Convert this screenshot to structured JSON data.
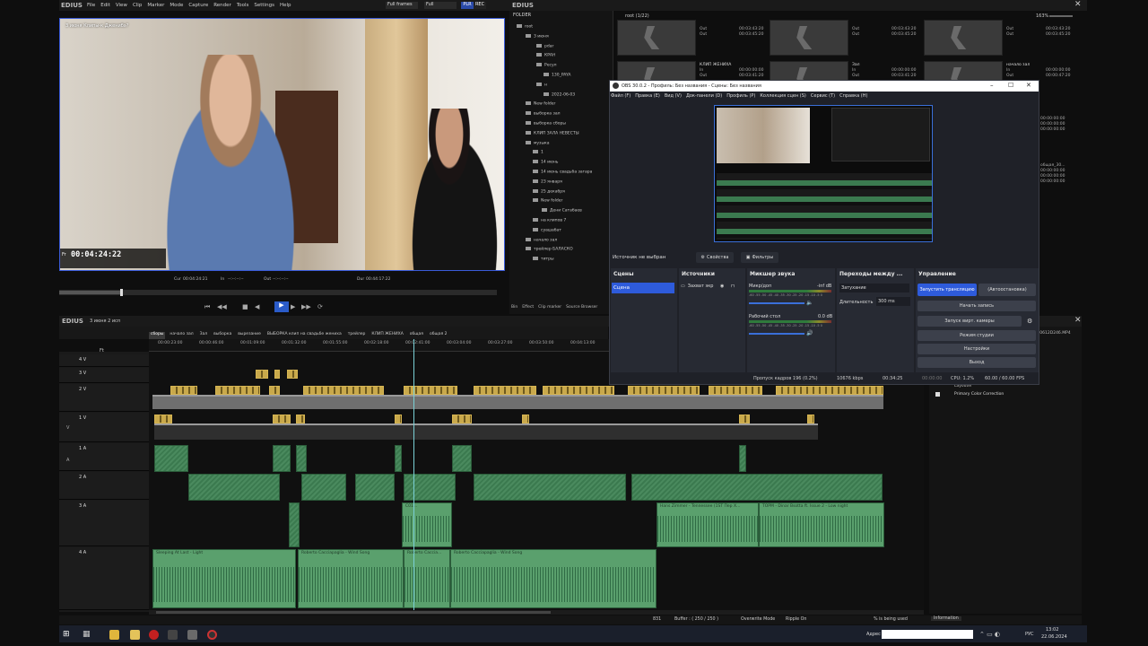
{
  "edius_left": {
    "logo": "EDIUS",
    "menu": [
      "File",
      "Edit",
      "View",
      "Clip",
      "Marker",
      "Mode",
      "Capture",
      "Render",
      "Tools",
      "Settings",
      "Help"
    ],
    "frames_dropdown": "Full frames",
    "quality_dropdown": "Full",
    "plr_label": "PLR",
    "rec_label": "REC"
  },
  "preview": {
    "overlay_title": "3 июня Клипы-к Дженибэ?",
    "timecode_prefix": "Fr",
    "timecode": "00:04:24:22",
    "cur_label": "Cur",
    "cur_value": "00:04:24:21",
    "in_label": "In",
    "in_value": "--:--:--:--",
    "out_label": "Out",
    "out_value": "--:--:--:--",
    "dur_label": "Dur",
    "dur_value": "00:44:17:22"
  },
  "edius_right": {
    "logo": "EDIUS",
    "folder_header": "FOLDER",
    "bin_path": "root (1/22)",
    "zoom": "163%",
    "bottom_tabs": [
      "Bin",
      "Effect",
      "Clip marker",
      "Source Browser"
    ]
  },
  "folder_tree": [
    "root",
    "3 июня",
    "рdar",
    "КРАН",
    "Ресул",
    "130_PAYA",
    "н",
    "2022-06-03",
    "New folder",
    "выборка зал",
    "выборка сборы",
    "КЛИП ЗАЛА НЕВЕСТЫ",
    "музыка",
    "1",
    "14 июнь",
    "14 июнь свадьба загара",
    "23 января",
    "25 декабря",
    "New folder",
    "Дени Сатабаев",
    "на клипов 7",
    "суашабат",
    "начало зал",
    "трейлер БАЛАСКО",
    "титры"
  ],
  "bin_clips": [
    {
      "name": "",
      "lines": [
        "Out",
        "Out"
      ],
      "times": [
        "00:03:43:20",
        "00:03:45:20"
      ]
    },
    {
      "name": "",
      "lines": [
        "Out",
        "Out"
      ],
      "times": [
        "00:03:43:20",
        "00:03:45:20"
      ]
    },
    {
      "name": "",
      "lines": [
        "Out",
        "Out"
      ],
      "times": [
        "00:03:43:20",
        "00:03:45:20"
      ]
    },
    {
      "name": "КЛИП ЖЕНИХА",
      "lines": [
        "In",
        "Out"
      ],
      "times": [
        "00:00:00:00",
        "00:03:41:20"
      ]
    },
    {
      "name": "Зал",
      "lines": [
        "In",
        "Out"
      ],
      "times": [
        "00:00:00:00",
        "00:03:41:20"
      ]
    },
    {
      "name": "начало зал",
      "lines": [
        "In",
        "Out"
      ],
      "times": [
        "00:00:00:00",
        "00:00:47:20"
      ]
    }
  ],
  "bin_side_times": [
    "00:00:00:00",
    "00:00:00:00",
    "00:00:00:00"
  ],
  "bin_side_name": "общая_30...",
  "bin_side_times2": [
    "00:00:00:00",
    "00:00:00:00",
    "00:00:00:00"
  ],
  "timeline": {
    "logo": "EDIUS",
    "sequence_name": "3 июня 2 исп",
    "ft_label": "Ft",
    "seq_tabs": [
      "сборы",
      "начало зал",
      "Зал",
      "выборка",
      "вырезание",
      "ВЫБОРКА клип на свадьбе жениха",
      "трейлер",
      "КЛИП ЖЕНИХА",
      "общая",
      "общая 2"
    ],
    "ruler": [
      "00:00:23:00",
      "00:00:46:00",
      "00:01:09:00",
      "00:01:32:00",
      "00:01:55:00",
      "00:02:18:00",
      "00:02:41:00",
      "00:03:04:00",
      "00:03:27:00",
      "00:03:50:00",
      "00:04:13:00"
    ],
    "tracks": [
      {
        "label": "4 V"
      },
      {
        "label": "3 V"
      },
      {
        "label": "2 V"
      },
      {
        "label": "1 V"
      },
      {
        "label": "1 A"
      },
      {
        "label": "2 A"
      },
      {
        "label": "3 A"
      },
      {
        "label": "4 A"
      }
    ],
    "v_marker": "V",
    "a_marker": "A",
    "clip_labels_3a": [
      "Hans Zimmer - Tennessee (1ST Пер Х...",
      "ТОРМ - Dinar Bsotta ft. Issue 2 - Low night",
      "С01...",
      "С0109"
    ],
    "clip_labels_4a": [
      "Sleeping At Last - Light",
      "Roberto Cacciapaglia - Wind Song",
      "Roberto Caccia...",
      "Roberto Cacciapaglia - Wind Song"
    ],
    "clip_labels_1a": [
      "С0...",
      "С0...",
      "С0...",
      "С0108"
    ]
  },
  "status_bar": {
    "num": "831",
    "buffer": "Buffer : ( 250 / 250 )",
    "mode": "Overwrite Mode",
    "ripple": "Ripple On",
    "percent": "% is being used"
  },
  "info_panel": {
    "tab": "Information",
    "file": "...0612D246.MP4",
    "item_header": "Layouter",
    "item": "Primary Color Correction"
  },
  "obs": {
    "title": "OBS 30.0.2 - Профиль: Без названия - Сцены: Без названия",
    "menu": [
      "Файл (F)",
      "Правка (E)",
      "Вид (V)",
      "Док-панели (D)",
      "Профиль (P)",
      "Коллекция сцен (S)",
      "Сервис (T)",
      "Справка (H)"
    ],
    "no_source": "Источник не выбран",
    "properties": "Свойства",
    "filters": "Фильтры",
    "scenes_title": "Сцены",
    "scene_item": "Сцена",
    "sources_title": "Источники",
    "source_item": "Захват экр",
    "mixer_title": "Микшер звука",
    "mic_name": "Микр/доп",
    "mic_db": "-inf dB",
    "desktop_name": "Рабочий стол",
    "desktop_db": "0.0 dB",
    "meter_scale": "-60 -55 -50 -45 -40 -35 -30 -25 -20 -15 -10 -5 0",
    "transitions_title": "Переходы между ...",
    "transition_type": "Затухание",
    "duration_label": "Длительность",
    "duration_value": "300 ms",
    "controls_title": "Управление",
    "btn_stream": "Запустить трансляцию",
    "btn_auto": "(Автоостановка)",
    "btn_record": "Начать запись",
    "btn_vcam": "Запуск вирт. камеры",
    "btn_studio": "Режим студии",
    "btn_settings": "Настройки",
    "btn_exit": "Выход",
    "status_dropped": "Пропуск кадров 196 (0.2%)",
    "status_kbps": "10676 kbps",
    "status_rec": "00:34:25",
    "status_time2": "00:00:00",
    "status_cpu": "CPU: 1.2%",
    "status_fps": "60.00 / 60.00 FPS"
  },
  "taskbar": {
    "address_label": "Адрес",
    "lang": "РУС",
    "time": "13:02",
    "date": "22.06.2024"
  }
}
